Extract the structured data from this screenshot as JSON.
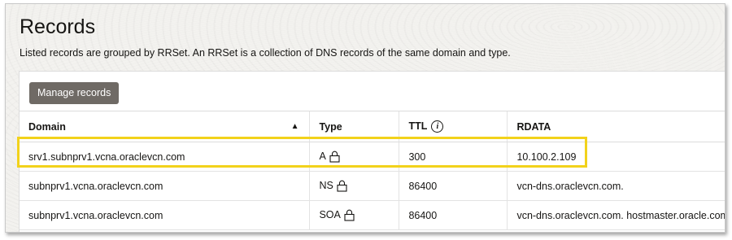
{
  "header": {
    "title": "Records",
    "subtitle": "Listed records are grouped by RRSet. An RRSet is a collection of DNS records of the same domain and type."
  },
  "toolbar": {
    "manage_label": "Manage records"
  },
  "table": {
    "columns": {
      "domain": "Domain",
      "type": "Type",
      "ttl": "TTL",
      "rdata": "RDATA"
    },
    "sort": {
      "column": "domain",
      "direction": "ascending",
      "icon": "sort-up-icon"
    },
    "rows": [
      {
        "domain": "srv1.subnprv1.vcna.oraclevcn.com",
        "type": "A",
        "ttl": "300",
        "rdata": "10.100.2.109"
      },
      {
        "domain": "subnprv1.vcna.oraclevcn.com",
        "type": "NS",
        "ttl": "86400",
        "rdata": "vcn-dns.oraclevcn.com."
      },
      {
        "domain": "subnprv1.vcna.oraclevcn.com",
        "type": "SOA",
        "ttl": "86400",
        "rdata": "vcn-dns.oraclevcn.com. hostmaster.oracle.com"
      }
    ]
  },
  "colors": {
    "highlight": "#f2d21b",
    "button": "#6f6a65"
  }
}
